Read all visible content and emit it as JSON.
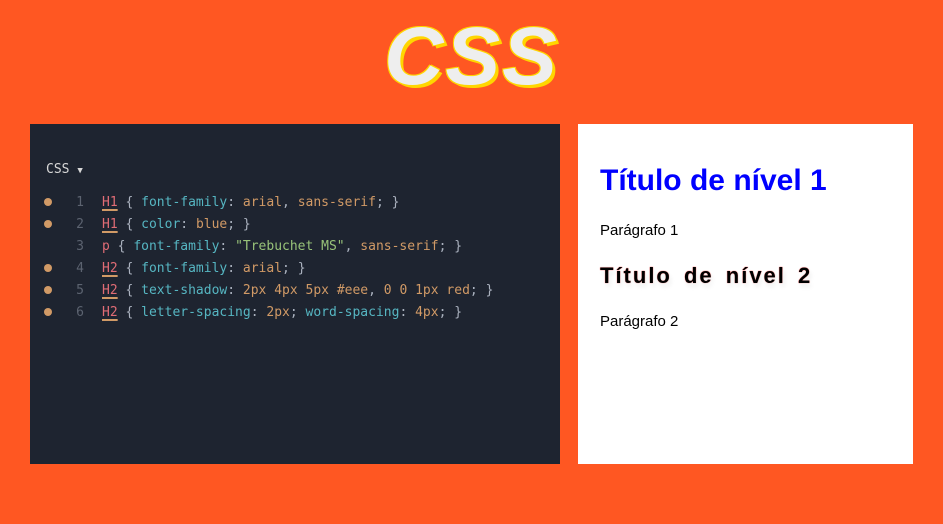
{
  "header": {
    "title": "CSS"
  },
  "editor": {
    "tab_label": "CSS",
    "lines": [
      {
        "dot": true,
        "n": "1",
        "sel": "H1",
        "underline": true,
        "rest": " { font-family: arial, sans-serif; }",
        "props": [
          {
            "prop": "font-family",
            "vals": [
              "arial",
              ", ",
              "sans-serif"
            ]
          }
        ]
      },
      {
        "dot": true,
        "n": "2",
        "sel": "H1",
        "underline": true,
        "rest": " { color: blue; }",
        "props": [
          {
            "prop": "color",
            "vals": [
              "blue"
            ]
          }
        ]
      },
      {
        "dot": false,
        "n": "3",
        "sel": "p",
        "underline": false,
        "rest": " { font-family: \"Trebuchet MS\", sans-serif; }",
        "props": [
          {
            "prop": "font-family",
            "vals": [
              "\"Trebuchet MS\"",
              ", ",
              "sans-serif"
            ]
          }
        ]
      },
      {
        "dot": true,
        "n": "4",
        "sel": "H2",
        "underline": true,
        "rest": " { font-family: arial; }",
        "props": [
          {
            "prop": "font-family",
            "vals": [
              "arial"
            ]
          }
        ]
      },
      {
        "dot": true,
        "n": "5",
        "sel": "H2",
        "underline": true,
        "rest": " { text-shadow: 2px 4px 5px #eee, 0 0 1px red; }",
        "props": [
          {
            "prop": "text-shadow",
            "vals": [
              "2px",
              " ",
              "4px",
              " ",
              "5px",
              " ",
              "#eee",
              ", ",
              "0",
              " ",
              "0",
              " ",
              "1px",
              " ",
              "red"
            ]
          }
        ]
      },
      {
        "dot": true,
        "n": "6",
        "sel": "H2",
        "underline": true,
        "rest": " { letter-spacing: 2px; word-spacing: 4px; }",
        "props": [
          {
            "prop": "letter-spacing",
            "vals": [
              "2px"
            ]
          },
          {
            "prop": "word-spacing",
            "vals": [
              "4px"
            ]
          }
        ]
      }
    ]
  },
  "preview": {
    "h1": "Título de nível 1",
    "p1": "Parágrafo 1",
    "h2": "Título de nível 2",
    "p2": "Parágrafo 2"
  }
}
